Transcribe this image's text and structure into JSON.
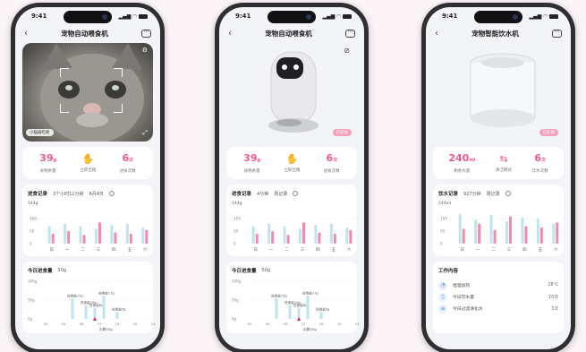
{
  "status_time": "9:41",
  "phones": [
    {
      "title": "宠物自动喂食机",
      "image_tag": "小猫偷吃呢",
      "stats": [
        {
          "value": "39",
          "unit": "g",
          "label": "食物余量"
        },
        {
          "icon": "hand-feed-icon",
          "label": "立即出粮"
        },
        {
          "value": "6",
          "unit": "次",
          "label": "进食次数"
        }
      ],
      "intake": {
        "title": "进食记录",
        "summary": "3个小时11分钟",
        "date": "6月4日",
        "y_label": "144g",
        "y_ticks": [
          "100",
          "50",
          "0"
        ],
        "days": [
          "日",
          "一",
          "二",
          "三",
          "四",
          "五",
          "六"
        ]
      },
      "today": {
        "title": "今日进食量",
        "amount": "50g",
        "y_ticks": [
          "100g",
          "50g",
          "0g"
        ],
        "annotations": [
          "进食量15g",
          "进食量10g",
          "进食量8g",
          "进食量17g",
          "进食量5g"
        ],
        "x_ticks": [
          "00",
          "04",
          "08",
          "12",
          "16",
          "20",
          "24"
        ],
        "footnote": "出粮25g"
      }
    },
    {
      "title": "宠物自动喂食机",
      "badge": "已在线",
      "stats": [
        {
          "value": "39",
          "unit": "g",
          "label": "食物余量"
        },
        {
          "icon": "hand-feed-icon",
          "label": "立即出粮"
        },
        {
          "value": "6",
          "unit": "次",
          "label": "进食次数"
        }
      ],
      "intake": {
        "title": "进食记录",
        "summary": "4分钟",
        "date": "周记录",
        "y_label": "144g",
        "y_ticks": [
          "100",
          "50",
          "0"
        ],
        "days": [
          "日",
          "一",
          "二",
          "三",
          "四",
          "五",
          "六"
        ]
      },
      "today": {
        "title": "今日进食量",
        "amount": "50g",
        "y_ticks": [
          "100g",
          "50g",
          "0g"
        ],
        "annotations": [
          "进食量15g",
          "进食量10g",
          "进食量8g",
          "进食量17g",
          "进食量5g"
        ],
        "x_ticks": [
          "00",
          "04",
          "08",
          "12",
          "16",
          "20",
          "24"
        ],
        "footnote": "出粮25g"
      }
    },
    {
      "title": "宠物智能饮水机",
      "badge": "已在线",
      "stats": [
        {
          "value": "240",
          "unit": "ml",
          "label": "剩余水量"
        },
        {
          "icon": "swap-icon",
          "label": "清洁模式"
        },
        {
          "value": "6",
          "unit": "次",
          "label": "饮水次数"
        }
      ],
      "intake": {
        "title": "饮水记录",
        "summary": "927分钟",
        "date": "周记录",
        "y_label": "144ml",
        "y_ticks": [
          "100",
          "50",
          "0"
        ],
        "days": [
          "日",
          "一",
          "二",
          "三",
          "四",
          "五",
          "六"
        ]
      },
      "work": {
        "title": "工作内容",
        "items": [
          {
            "icon": "thermometer-icon",
            "label": "恒温加热",
            "value": "28℃"
          },
          {
            "icon": "drop-icon",
            "label": "今日饮水量",
            "value": "10次"
          },
          {
            "icon": "filter-icon",
            "label": "今日过滤净化水",
            "value": "3次"
          }
        ]
      }
    }
  ],
  "chart_data": [
    {
      "type": "bar",
      "title": "进食记录",
      "categories": [
        "日",
        "一",
        "二",
        "三",
        "四",
        "五",
        "六"
      ],
      "series": [],
      "values_pink": [
        40,
        50,
        35,
        85,
        45,
        40,
        55
      ],
      "values_blue": [
        70,
        80,
        70,
        60,
        75,
        80,
        65
      ],
      "ylim": [
        0,
        144
      ]
    },
    {
      "type": "bar",
      "title": "进食记录",
      "categories": [
        "日",
        "一",
        "二",
        "三",
        "四",
        "五",
        "六"
      ],
      "values_pink": [
        40,
        50,
        35,
        85,
        45,
        40,
        55
      ],
      "values_blue": [
        70,
        80,
        70,
        60,
        75,
        80,
        65
      ],
      "ylim": [
        0,
        144
      ]
    },
    {
      "type": "bar",
      "title": "饮水记录",
      "categories": [
        "日",
        "一",
        "二",
        "三",
        "四",
        "五",
        "六"
      ],
      "values_pink": [
        60,
        80,
        55,
        110,
        70,
        65,
        85
      ],
      "values_blue": [
        120,
        95,
        115,
        90,
        105,
        100,
        80
      ],
      "ylim": [
        0,
        144
      ]
    },
    {
      "type": "bar",
      "title": "今日进食量",
      "x_hours": [
        6,
        9,
        11,
        13,
        16
      ],
      "values": [
        15,
        10,
        8,
        17,
        5
      ],
      "ylim": [
        0,
        100
      ]
    }
  ]
}
